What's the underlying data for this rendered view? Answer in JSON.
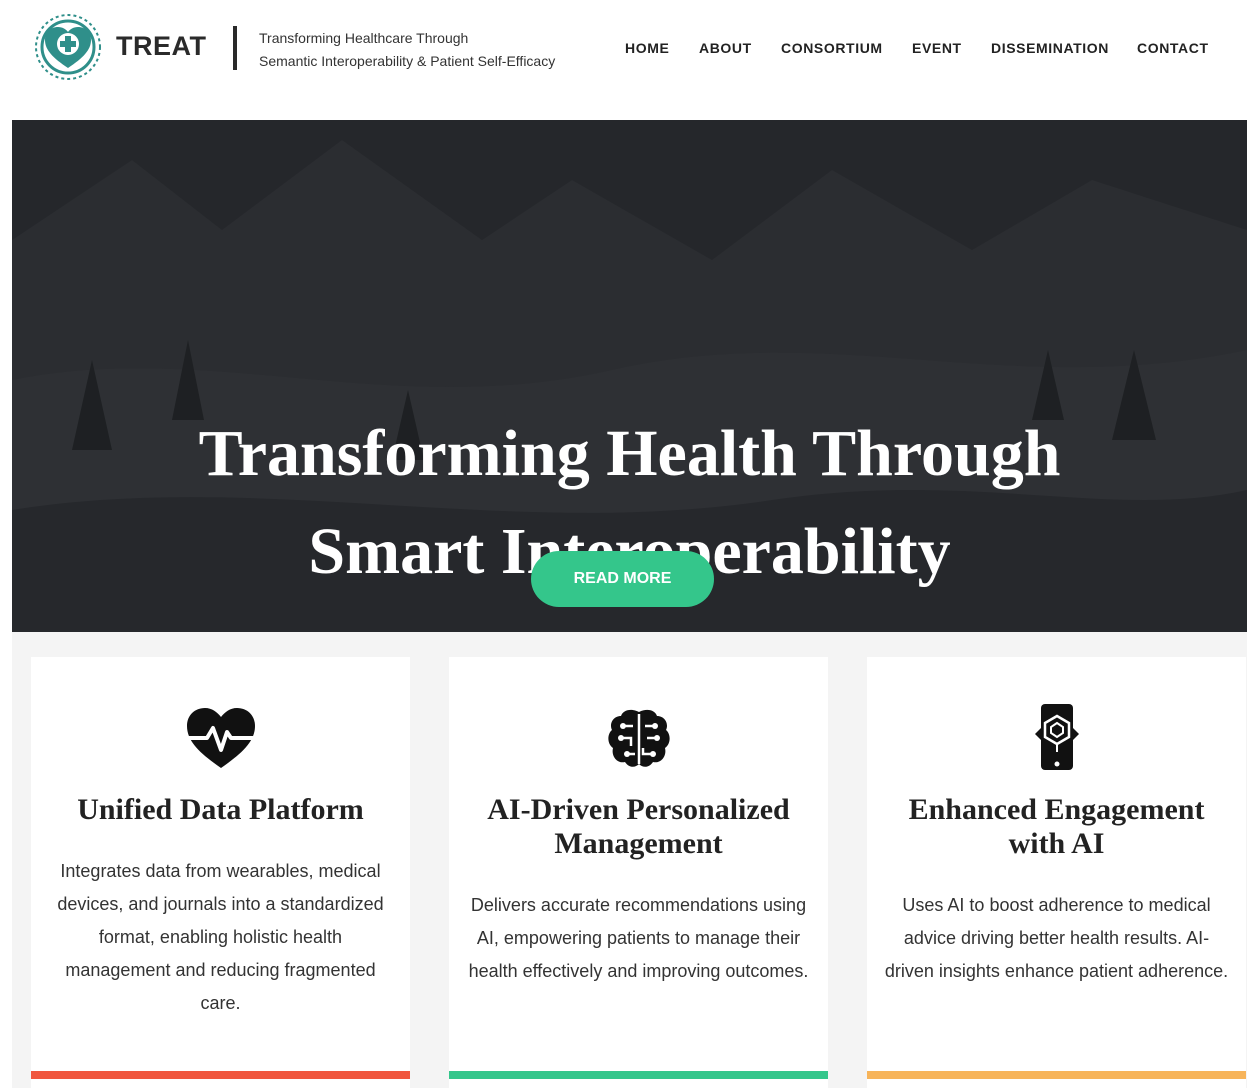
{
  "header": {
    "brand": "TREAT",
    "tagline_line1": "Transforming Healthcare Through",
    "tagline_line2": "Semantic Interoperability & Patient Self-Efficacy",
    "nav": [
      "HOME",
      "ABOUT",
      "CONSORTIUM",
      "EVENT",
      "DISSEMINATION",
      "CONTACT"
    ]
  },
  "hero": {
    "title_line1": "Transforming Health Through",
    "title_line2": "Smart Interoperability",
    "button": "READ MORE"
  },
  "features": [
    {
      "icon": "heart-pulse-icon",
      "title": "Unified Data Platform",
      "description": "Integrates data from wearables, medical devices, and journals into a standardized format, enabling holistic health management and reducing fragmented care.",
      "accent": "#f0563e"
    },
    {
      "icon": "brain-circuit-icon",
      "title": "AI-Driven Personalized Management",
      "description": "Delivers accurate recommendations using AI, empowering patients to manage their health effectively and improving outcomes.",
      "accent": "#34c68b"
    },
    {
      "icon": "smartphone-ar-icon",
      "title": "Enhanced Engagement with AI",
      "description": "Uses AI to boost adherence to medical advice driving better health results. AI-driven insights enhance patient adherence.",
      "accent": "#f7b45a"
    }
  ],
  "colors": {
    "brand_teal": "#2f8f8a",
    "button_green": "#34c68b",
    "hero_bg": "#202226"
  }
}
